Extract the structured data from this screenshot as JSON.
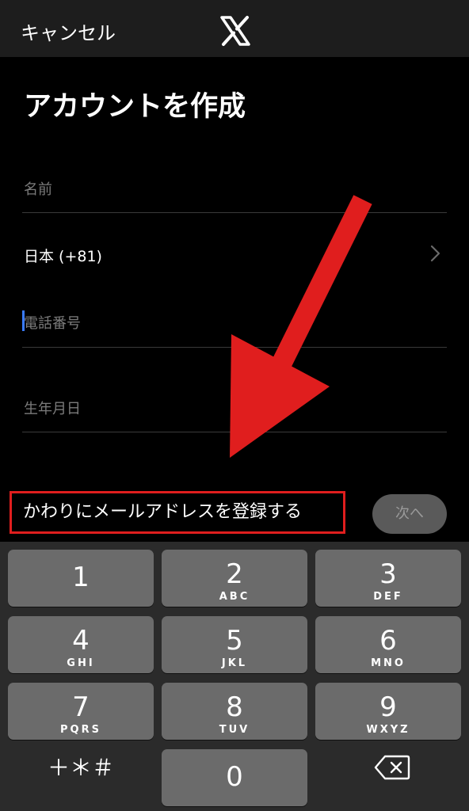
{
  "nav": {
    "cancel_label": "キャンセル",
    "logo": "x-logo-icon"
  },
  "title": "アカウントを作成",
  "form": {
    "name_placeholder": "名前",
    "country": "日本 (+81)",
    "phone_placeholder": "電話番号",
    "birthday_placeholder": "生年月日"
  },
  "actions": {
    "email_link": "かわりにメールアドレスを登録する",
    "next_label": "次へ"
  },
  "keyboard": {
    "keys": [
      {
        "num": "1",
        "letters": ""
      },
      {
        "num": "2",
        "letters": "ABC"
      },
      {
        "num": "3",
        "letters": "DEF"
      },
      {
        "num": "4",
        "letters": "GHI"
      },
      {
        "num": "5",
        "letters": "JKL"
      },
      {
        "num": "6",
        "letters": "MNO"
      },
      {
        "num": "7",
        "letters": "PQRS"
      },
      {
        "num": "8",
        "letters": "TUV"
      },
      {
        "num": "9",
        "letters": "WXYZ"
      },
      {
        "num": "0",
        "letters": ""
      }
    ],
    "symbols": "＋＊＃",
    "delete_icon": "backspace-icon"
  },
  "colors": {
    "highlight": "#e01e1e",
    "caret": "#3a7bff"
  }
}
